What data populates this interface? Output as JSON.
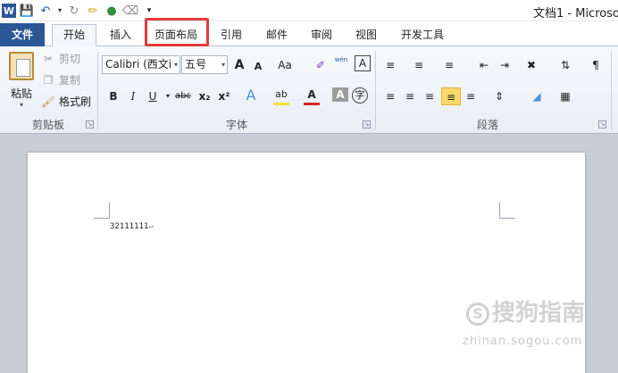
{
  "window": {
    "title": "文档1 - Microso",
    "quick_access": [
      "word-logo-icon",
      "save-icon",
      "undo-icon",
      "redo-icon",
      "format-painter-icon",
      "color-icon",
      "eraser-icon",
      "customize-icon"
    ],
    "word_logo": "W"
  },
  "tabs": [
    {
      "label": "文件"
    },
    {
      "label": "开始"
    },
    {
      "label": "插入"
    },
    {
      "label": "页面布局"
    },
    {
      "label": "引用"
    },
    {
      "label": "邮件"
    },
    {
      "label": "审阅"
    },
    {
      "label": "视图"
    },
    {
      "label": "开发工具"
    }
  ],
  "ribbon": {
    "clipboard": {
      "paste": "粘贴",
      "cut": "剪切",
      "copy": "复制",
      "format_painter": "格式刷",
      "group_label": "剪贴板"
    },
    "font": {
      "font_name": "Calibri (西文i",
      "font_size": "五号",
      "grow": "A",
      "shrink": "A",
      "change_case": "Aa",
      "bold": "B",
      "italic": "I",
      "underline": "U",
      "strikethrough": "abc",
      "subscript": "x₂",
      "superscript": "x²",
      "text_effects": "A",
      "highlight": "ab",
      "font_color": "A",
      "char_shading": "A",
      "enclose": "字",
      "pinyin": "wén",
      "border": "A",
      "group_label": "字体"
    },
    "paragraph": {
      "group_label": "段落"
    }
  },
  "document": {
    "text": "32111111",
    "para_mark": "↵"
  },
  "watermark": {
    "brand": "搜狗指南",
    "url": "zhinan.sogou.com",
    "icon": "S"
  },
  "colors": {
    "file_tab": "#2b5797",
    "highlight_box": "#e23b3b",
    "accent_yellow": "#fbd96b"
  }
}
